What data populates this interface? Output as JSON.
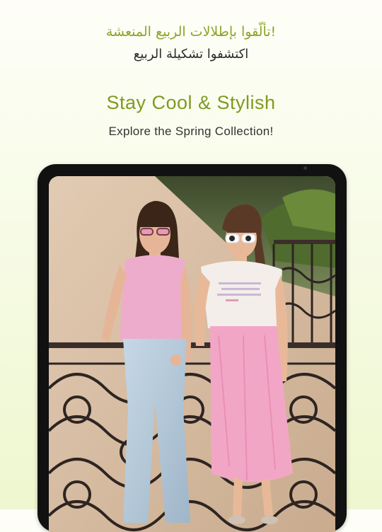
{
  "header": {
    "arabic_title": "!تألّقوا بإطلالات الربيع المنعشة",
    "arabic_subtitle": "اكتشفوا تشكيلة الربيع",
    "title": "Stay Cool & Stylish",
    "subtitle": "Explore the Spring Collection!"
  },
  "colors": {
    "accent": "#7f9a22",
    "background_top": "#fefef8",
    "background_bottom": "#eef7cf",
    "device_frame": "#111111"
  },
  "hero": {
    "image_subject": "two-models-spring-outfits",
    "device": "tablet"
  }
}
